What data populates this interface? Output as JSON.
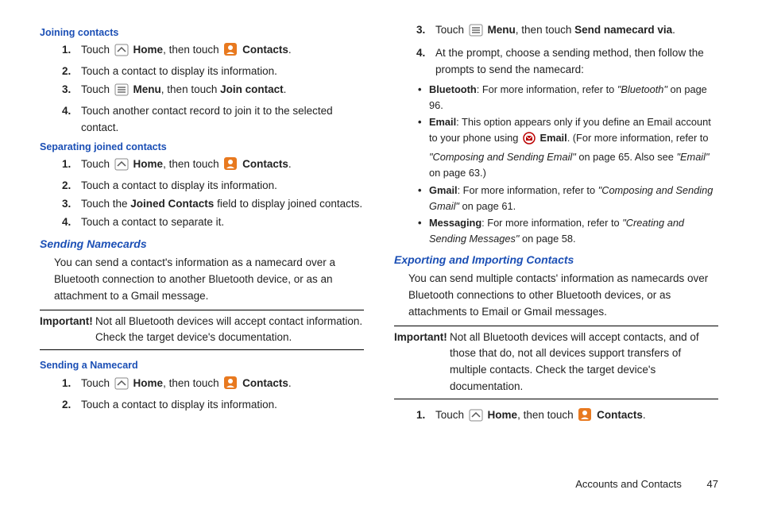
{
  "labels": {
    "home": "Home",
    "contacts": "Contacts",
    "menu": "Menu",
    "email": "Email",
    "important": "Important!"
  },
  "joining": {
    "heading": "Joining contacts",
    "steps": {
      "s1a": "Touch ",
      "s1b": ", then touch ",
      "s1c": ".",
      "s2": "Touch a contact to display its information.",
      "s3a": "Touch ",
      "s3b": ", then touch ",
      "s3c": "Join contact",
      "s3d": ".",
      "s4": "Touch another contact record to join it to the selected contact."
    }
  },
  "separating": {
    "heading": "Separating joined contacts",
    "steps": {
      "s1a": "Touch ",
      "s1b": ", then touch ",
      "s1c": ".",
      "s2": "Touch a contact to display its information.",
      "s3a": "Touch the ",
      "s3b": "Joined Contacts",
      "s3c": " field to display joined contacts.",
      "s4": "Touch a contact to separate it."
    }
  },
  "sending_namecards": {
    "heading": "Sending Namecards",
    "intro": "You can send a contact's information as a namecard over a Bluetooth connection to another Bluetooth device, or as an attachment to a Gmail message.",
    "important": "Not all Bluetooth devices will accept contact information. Check the target device's documentation."
  },
  "sending_a_namecard": {
    "heading": "Sending a Namecard",
    "steps": {
      "s1a": "Touch ",
      "s1b": ", then touch ",
      "s1c": ".",
      "s2": "Touch a contact to display its information.",
      "s3a": "Touch ",
      "s3b": ", then touch ",
      "s3c": "Send namecard via",
      "s3d": "."
    }
  },
  "send_method": {
    "s4": "At the prompt, choose a sending method, then follow the prompts to send the namecard:",
    "bt_name": "Bluetooth",
    "bt_text": ": For more information, refer to ",
    "bt_ref": "\"Bluetooth\"",
    "bt_after": "  on page 96.",
    "em_name": "Email",
    "em_text1": ": This option appears only if you define an Email account to your phone using ",
    "em_text2": ". (For more information, refer to ",
    "em_ref": "\"Composing and Sending Email\"",
    "em_after": "  on page 65. Also see ",
    "em_ref2": "\"Email\"",
    "em_after2": " on page 63.)",
    "gm_name": "Gmail",
    "gm_text": ": For more information, refer to ",
    "gm_ref": "\"Composing and Sending Gmail\"",
    "gm_after": "  on page 61.",
    "ms_name": "Messaging",
    "ms_text": ": For more information, refer to ",
    "ms_ref": "\"Creating and Sending Messages\"",
    "ms_after": "  on page 58."
  },
  "exporting": {
    "heading": "Exporting and Importing Contacts",
    "intro": "You can send multiple contacts' information as namecards over Bluetooth connections to other Bluetooth devices, or as attachments to Email or Gmail messages.",
    "important": "Not all Bluetooth devices will accept contacts, and of those that do, not all devices support transfers of multiple contacts. Check the target device's documentation.",
    "steps": {
      "s1a": "Touch ",
      "s1b": ", then touch ",
      "s1c": "."
    }
  },
  "footer": {
    "section": "Accounts and Contacts",
    "page": "47"
  }
}
